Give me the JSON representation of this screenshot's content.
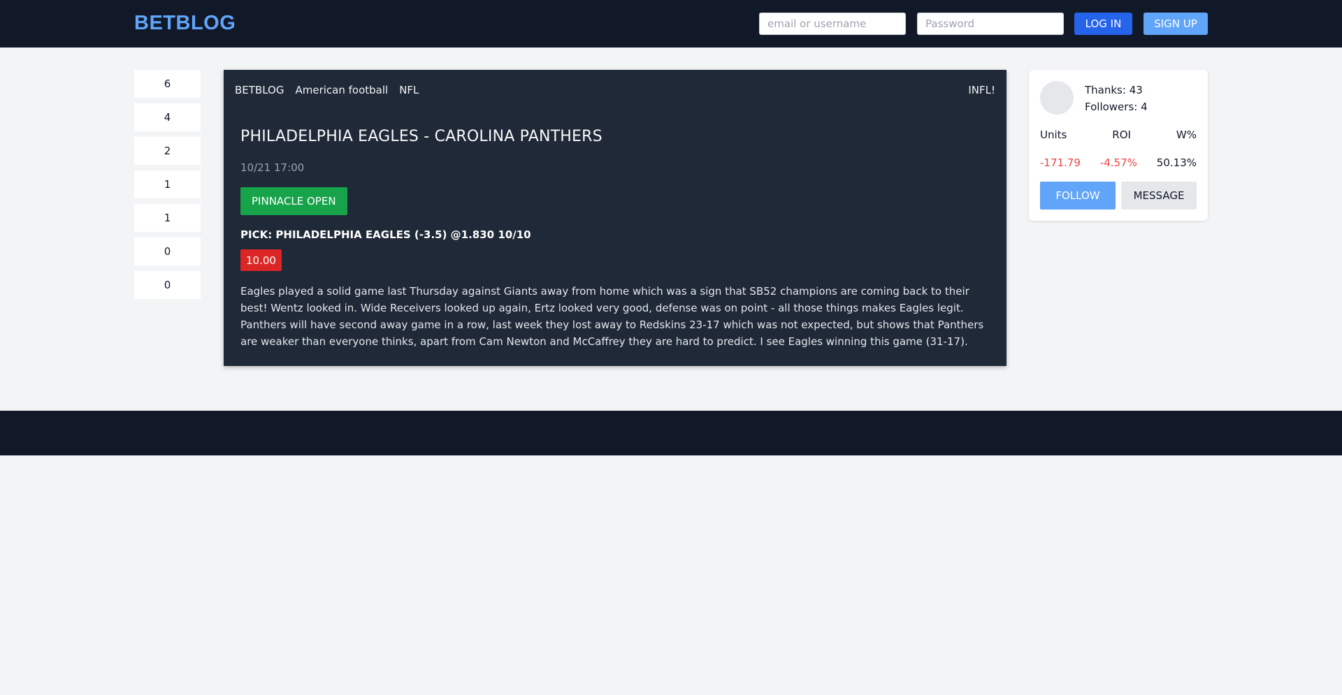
{
  "header": {
    "logo": "BETBLOG",
    "username_placeholder": "email or username",
    "password_placeholder": "Password",
    "login_label": "LOG IN",
    "signup_label": "SIGN UP"
  },
  "votes": [
    "6",
    "4",
    "2",
    "1",
    "1",
    "0",
    "0"
  ],
  "post": {
    "breadcrumbs": [
      "BETBLOG",
      "American football",
      "NFL"
    ],
    "tag": "INFL!",
    "title": "PHILADELPHIA EAGLES - CAROLINA PANTHERS",
    "date": "10/21 17:00",
    "bookmaker_button": "PINNACLE OPEN",
    "pick": "PICK: PHILADELPHIA EAGLES (-3.5) @1.830 10/10",
    "stake": "10.00",
    "analysis": "Eagles played a solid game last Thursday against Giants away from home which was a sign that SB52 champions are coming back to their best! Wentz looked in. Wide Receivers looked up again, Ertz looked very good, defense was on point - all those things makes Eagles legit. Panthers will have second away game in a row, last week they lost away to Redskins 23-17 which was not expected, but shows that Panthers are weaker than everyone thinks, apart from Cam Newton and McCaffrey they are hard to predict. I see Eagles winning this game (31-17)."
  },
  "profile": {
    "thanks": "Thanks: 43",
    "followers": "Followers: 4",
    "metric_labels": [
      "Units",
      "ROI",
      "W%"
    ],
    "metric_values": [
      "-171.79",
      "-4.57%",
      "50.13%"
    ],
    "follow_label": "FOLLOW",
    "message_label": "MESSAGE"
  },
  "colors": {
    "brand": "#60a5fa",
    "dark": "#111827",
    "card": "#1f2937",
    "positive_button": "#16a34a",
    "stake_badge": "#dc2626",
    "negative_text": "#ef4444"
  }
}
